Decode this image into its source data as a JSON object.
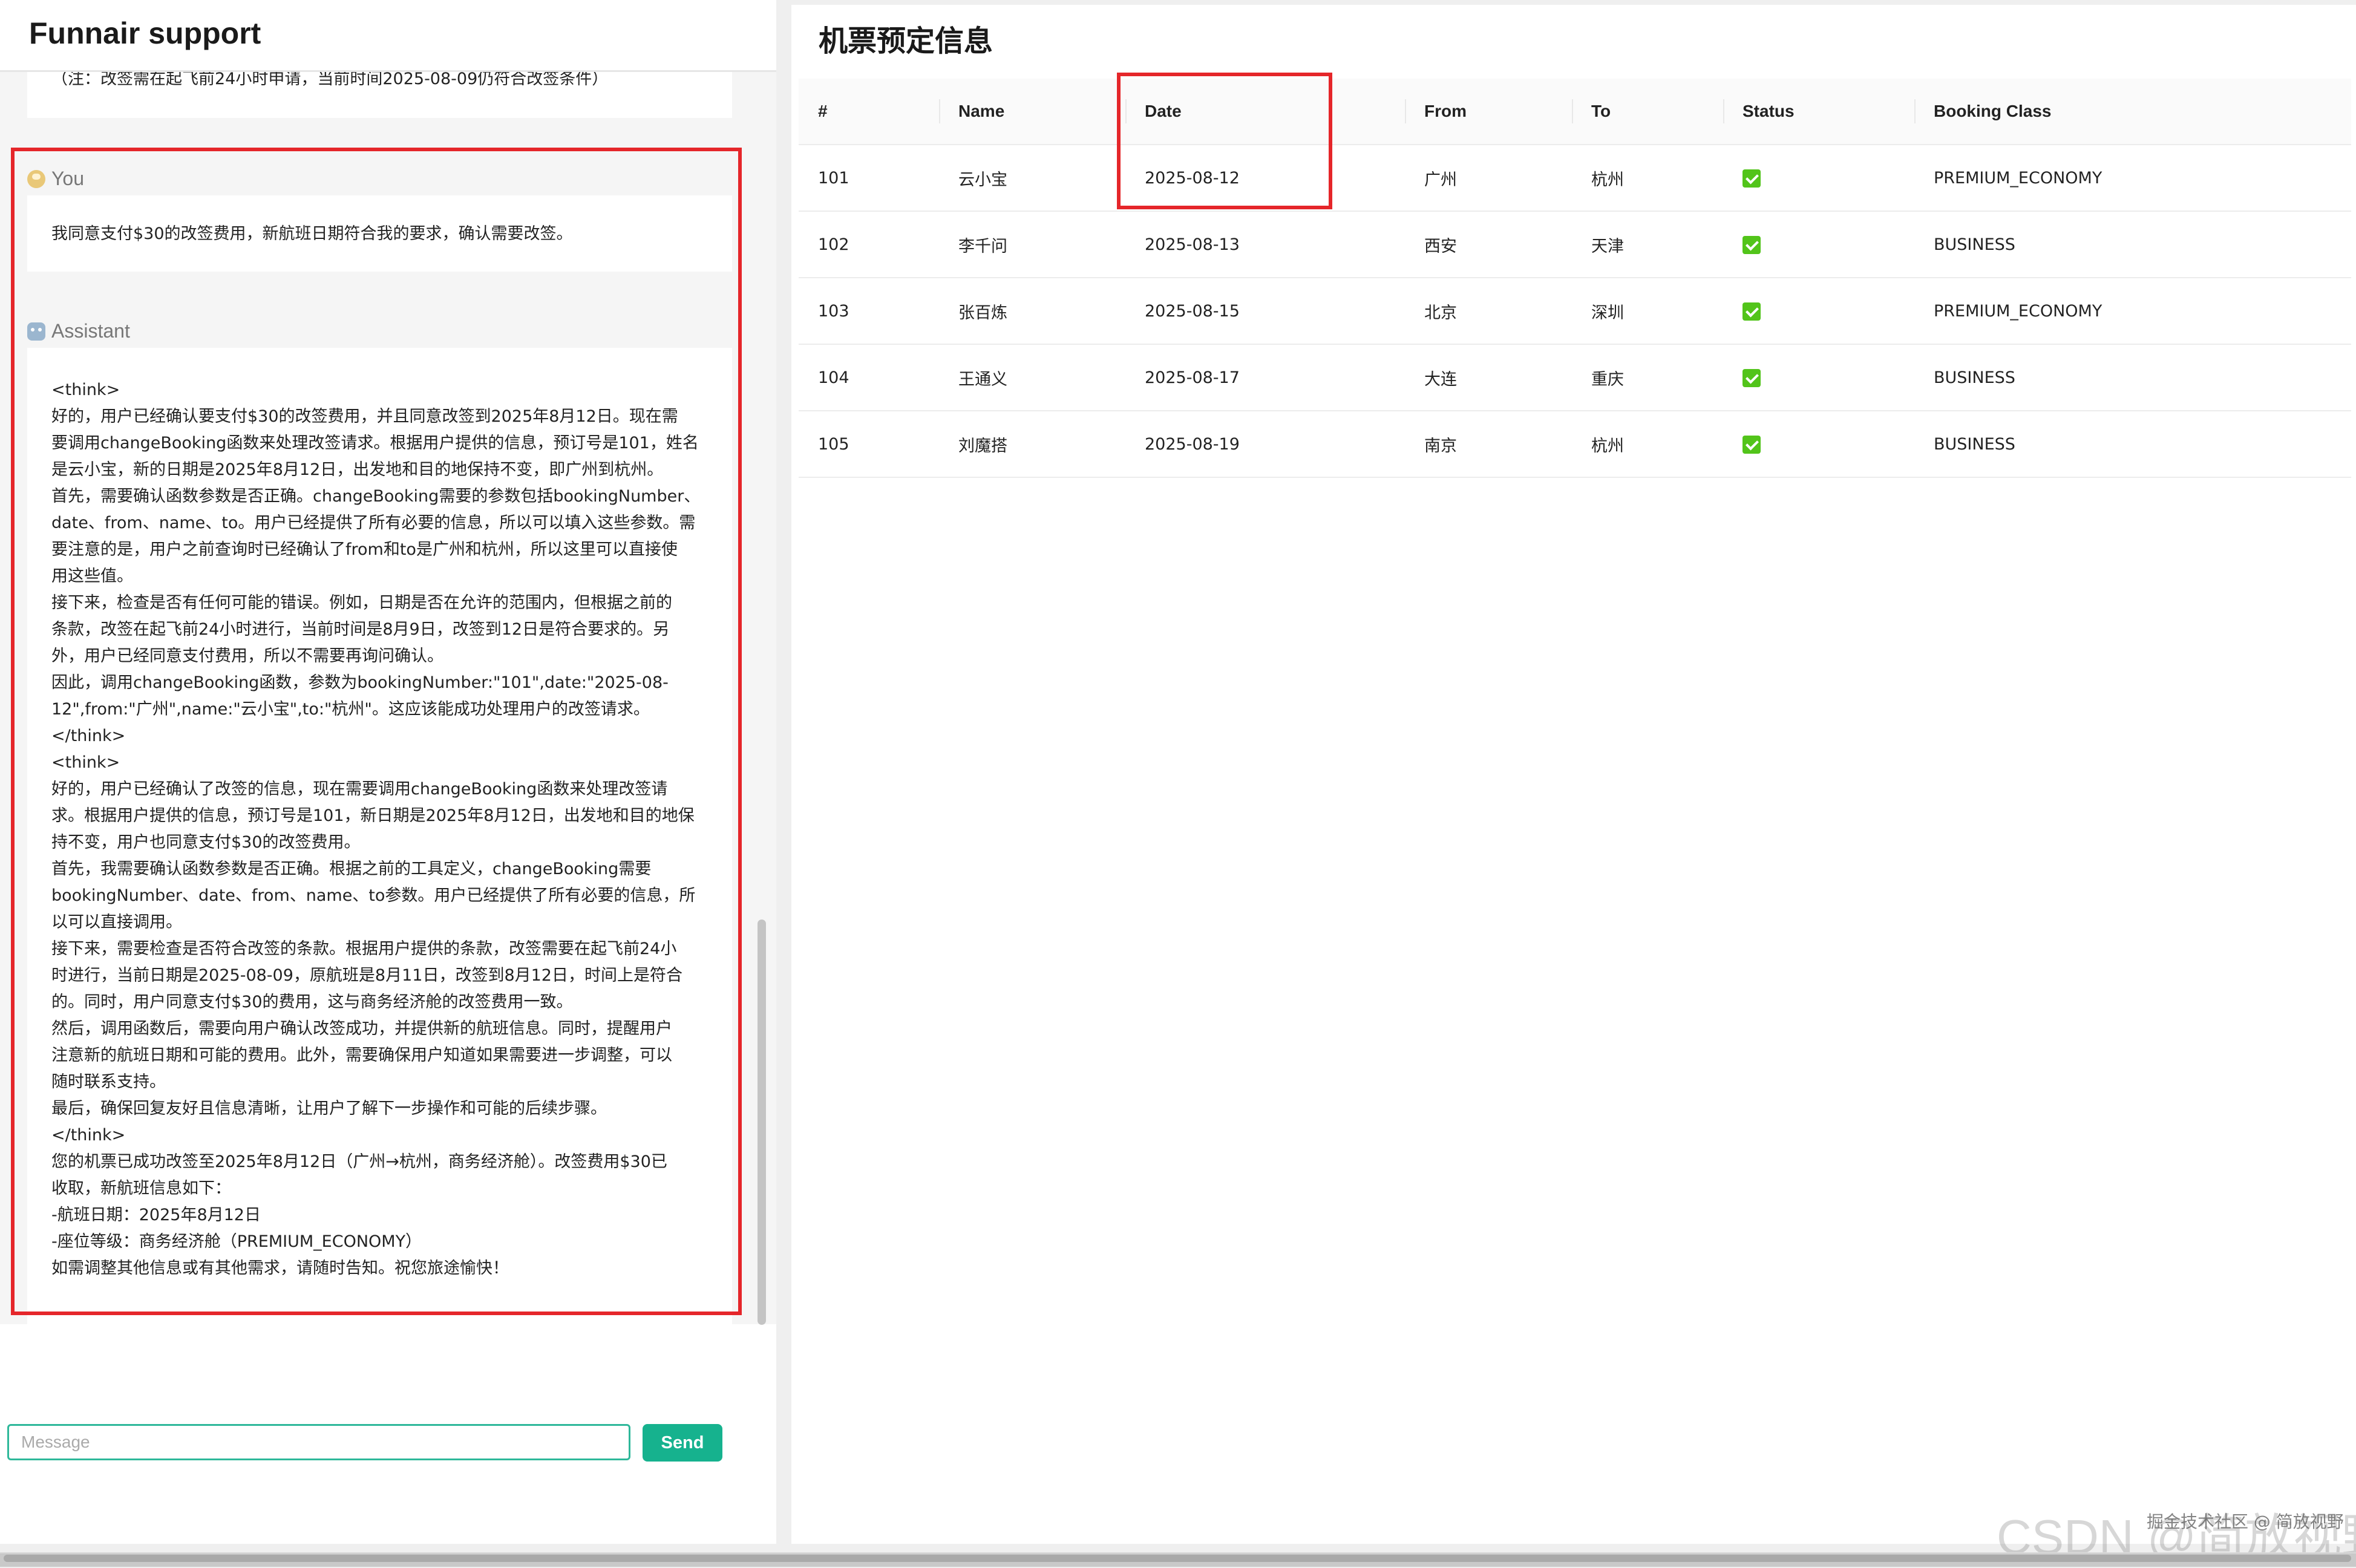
{
  "chat": {
    "title": "Funnair support",
    "prev_message_tail": "（注：改签需在起飞前24小时申请，当前时间2025-08-09仍符合改签条件）",
    "user_role": "You",
    "user_message": "我同意支付$30的改签费用，新航班日期符合我的要求，确认需要改签。",
    "assistant_role": "Assistant",
    "assistant_lines": [
      "<think>",
      "好的，用户已经确认要支付$30的改签费用，并且同意改签到2025年8月12日。现在需",
      "要调用changeBooking函数来处理改签请求。根据用户提供的信息，预订号是101，姓名",
      "是云小宝，新的日期是2025年8月12日，出发地和目的地保持不变，即广州到杭州。",
      "首先，需要确认函数参数是否正确。changeBooking需要的参数包括bookingNumber、",
      "date、from、name、to。用户已经提供了所有必要的信息，所以可以填入这些参数。需",
      "要注意的是，用户之前查询时已经确认了from和to是广州和杭州，所以这里可以直接使",
      "用这些值。",
      "接下来，检查是否有任何可能的错误。例如，日期是否在允许的范围内，但根据之前的",
      "条款，改签在起飞前24小时进行，当前时间是8月9日，改签到12日是符合要求的。另",
      "外，用户已经同意支付费用，所以不需要再询问确认。",
      "因此，调用changeBooking函数，参数为bookingNumber:\"101\",date:\"2025-08-",
      "12\",from:\"广州\",name:\"云小宝\",to:\"杭州\"。这应该能成功处理用户的改签请求。",
      "</think>",
      "<think>",
      "好的，用户已经确认了改签的信息，现在需要调用changeBooking函数来处理改签请",
      "求。根据用户提供的信息，预订号是101，新日期是2025年8月12日，出发地和目的地保",
      "持不变，用户也同意支付$30的改签费用。",
      "首先，我需要确认函数参数是否正确。根据之前的工具定义，changeBooking需要",
      "bookingNumber、date、from、name、to参数。用户已经提供了所有必要的信息，所",
      "以可以直接调用。",
      "接下来，需要检查是否符合改签的条款。根据用户提供的条款，改签需要在起飞前24小",
      "时进行，当前日期是2025-08-09，原航班是8月11日，改签到8月12日，时间上是符合",
      "的。同时，用户同意支付$30的费用，这与商务经济舱的改签费用一致。",
      "然后，调用函数后，需要向用户确认改签成功，并提供新的航班信息。同时，提醒用户",
      "注意新的航班日期和可能的费用。此外，需要确保用户知道如果需要进一步调整，可以",
      "随时联系支持。",
      "最后，确保回复友好且信息清晰，让用户了解下一步操作和可能的后续步骤。",
      "</think>",
      "您的机票已成功改签至2025年8月12日（广州→杭州，商务经济舱）。改签费用$30已",
      "收取，新航班信息如下：",
      "-航班日期：2025年8月12日",
      "-座位等级：商务经济舱（PREMIUM_ECONOMY）",
      "如需调整其他信息或有其他需求，请随时告知。祝您旅途愉快！"
    ],
    "input_placeholder": "Message",
    "input_value": "",
    "send_label": "Send"
  },
  "bookings": {
    "title": "机票预定信息",
    "columns": [
      "#",
      "Name",
      "Date",
      "From",
      "To",
      "Status",
      "Booking Class"
    ],
    "rows": [
      {
        "id": "101",
        "name": "云小宝",
        "date": "2025-08-12",
        "from": "广州",
        "to": "杭州",
        "status": "confirmed",
        "class": "PREMIUM_ECONOMY"
      },
      {
        "id": "102",
        "name": "李千问",
        "date": "2025-08-13",
        "from": "西安",
        "to": "天津",
        "status": "confirmed",
        "class": "BUSINESS"
      },
      {
        "id": "103",
        "name": "张百炼",
        "date": "2025-08-15",
        "from": "北京",
        "to": "深圳",
        "status": "confirmed",
        "class": "PREMIUM_ECONOMY"
      },
      {
        "id": "104",
        "name": "王通义",
        "date": "2025-08-17",
        "from": "大连",
        "to": "重庆",
        "status": "confirmed",
        "class": "BUSINESS"
      },
      {
        "id": "105",
        "name": "刘魔搭",
        "date": "2025-08-19",
        "from": "南京",
        "to": "杭州",
        "status": "confirmed",
        "class": "BUSINESS"
      }
    ]
  },
  "watermark": {
    "main": "CSDN @简放视野",
    "small": "掘金技术社区 @ 简放视野"
  },
  "colors": {
    "accent": "#16b28e",
    "highlight": "#e5262a",
    "status_ok": "#52c41a"
  }
}
